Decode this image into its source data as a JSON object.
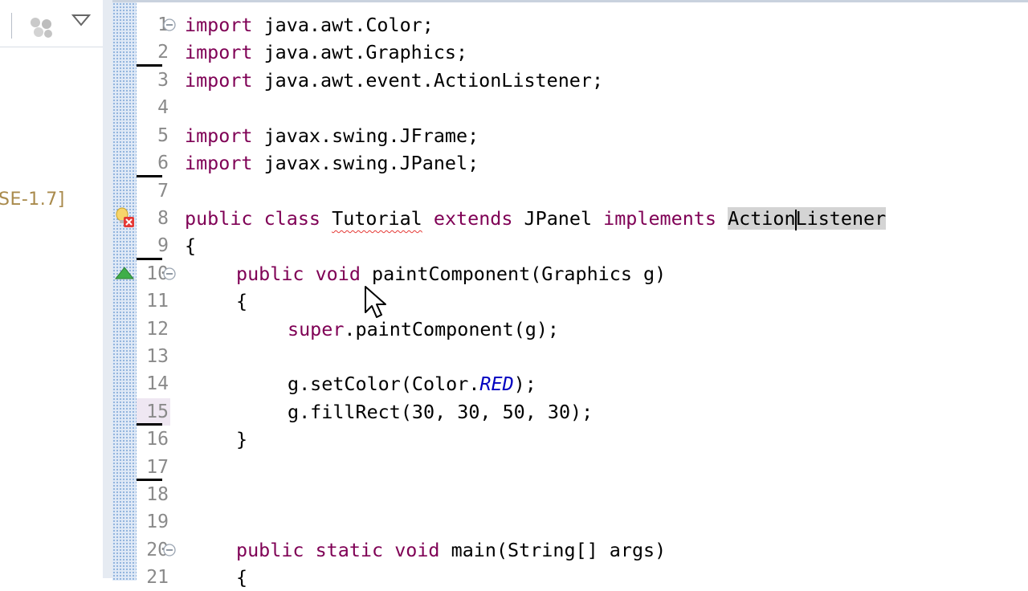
{
  "package_explorer": {
    "jre_label": "SE-1.7]"
  },
  "editor": {
    "lines": [
      {
        "num": "1",
        "t1": "import",
        "t2": " java.awt.Color;"
      },
      {
        "num": "2",
        "t1": "import",
        "t2": " java.awt.Graphics;"
      },
      {
        "num": "3",
        "t1": "import",
        "t2": " java.awt.event.ActionListener;"
      },
      {
        "num": "4"
      },
      {
        "num": "5",
        "t1": "import",
        "t2": " javax.swing.JFrame;"
      },
      {
        "num": "6",
        "t1": "import",
        "t2": " javax.swing.JPanel;"
      },
      {
        "num": "7"
      },
      {
        "num": "8",
        "kw1": "public",
        "kw2": "class",
        "cls": "Tutorial",
        "kw3": "extends",
        "sup": "JPanel",
        "kw4": "implements",
        "iface_a": "Action",
        "iface_b": "Listener"
      },
      {
        "num": "9",
        "t": "{"
      },
      {
        "num": "10",
        "kw1": "public",
        "kw2": "void",
        "rest": "paintComponent(Graphics g)"
      },
      {
        "num": "11",
        "t": "{"
      },
      {
        "num": "12",
        "kw": "super",
        "rest": ".paintComponent(g);"
      },
      {
        "num": "13"
      },
      {
        "num": "14",
        "pre": "g.setColor(Color.",
        "const": "RED",
        "post": ");"
      },
      {
        "num": "15",
        "t": "g.fillRect(30, 30, 50, 30);"
      },
      {
        "num": "16",
        "t": "}"
      },
      {
        "num": "17"
      },
      {
        "num": "18"
      },
      {
        "num": "19"
      },
      {
        "num": "20",
        "kw1": "public",
        "kw2": "static",
        "kw3": "void",
        "rest": "main(String[] args)"
      },
      {
        "num": "21",
        "t": "{"
      }
    ]
  },
  "icons": {
    "package_toolbar": "packages-icon",
    "view_menu": "view-menu-triangle-icon",
    "error": "error-lightbulb-icon",
    "override": "override-triangle-icon",
    "fold": "fold-minus-icon",
    "cursor": "mouse-pointer-icon"
  },
  "colors": {
    "keyword": "#7f0055",
    "constant": "#0000c0",
    "error_squiggle": "#e53935",
    "occurrence_highlight": "#d4d4d4"
  }
}
